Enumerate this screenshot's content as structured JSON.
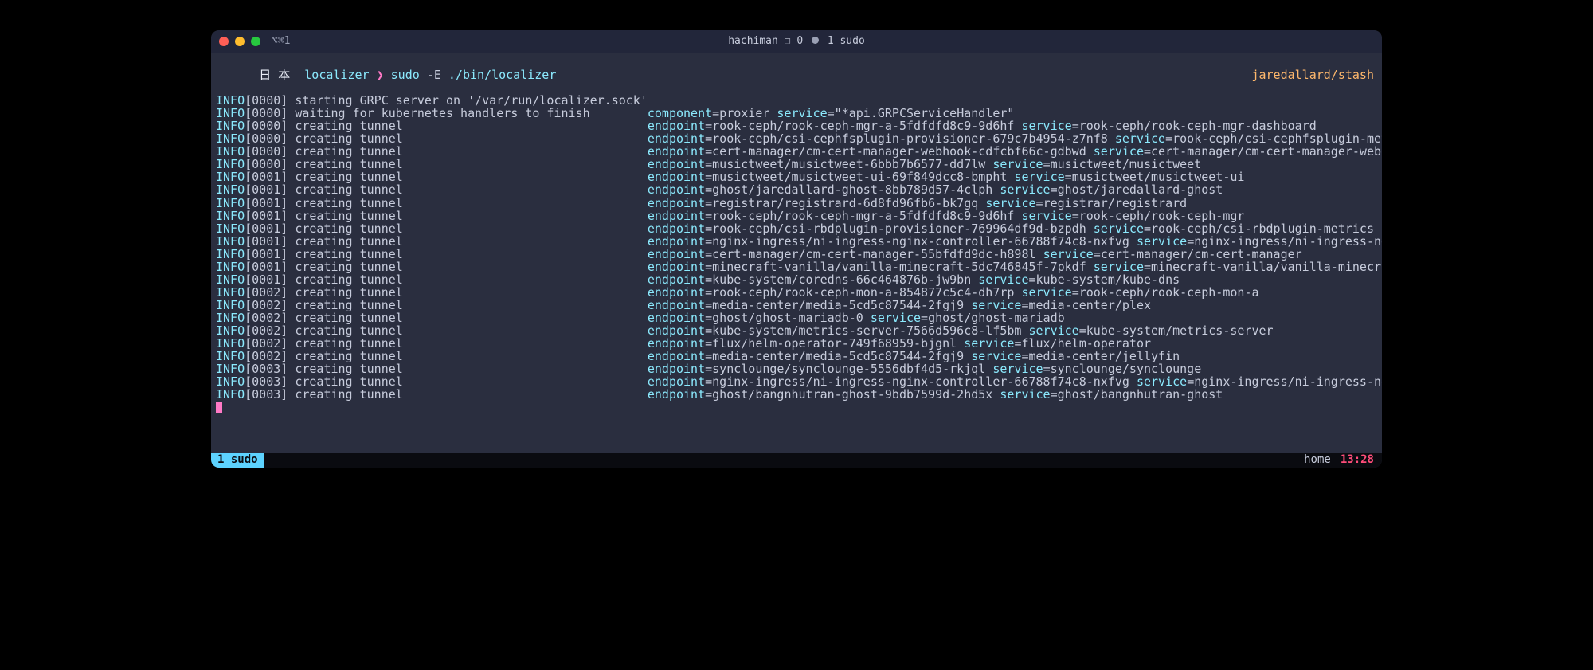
{
  "titlebar": {
    "left": "⌥⌘1",
    "host": "hachiman",
    "pane_glyph": "❐",
    "pane_count": "0",
    "proc": "1 sudo"
  },
  "prompt": {
    "prefix": "日 本 ",
    "host": "localizer",
    "caret": "❯",
    "cmd": "sudo",
    "flag": "-E",
    "path": "./bin/localizer",
    "branch": "jaredallard/stash"
  },
  "msg_col": 60,
  "logs": [
    {
      "level": "INFO",
      "ts": "0000",
      "msg": "starting GRPC server on '/var/run/localizer.sock'"
    },
    {
      "level": "INFO",
      "ts": "0000",
      "msg": "waiting for kubernetes handlers to finish",
      "kv": [
        [
          "component",
          "proxier"
        ],
        [
          "service",
          "\"*api.GRPCServiceHandler\""
        ]
      ]
    },
    {
      "level": "INFO",
      "ts": "0000",
      "msg": "creating tunnel",
      "kv": [
        [
          "endpoint",
          "rook-ceph/rook-ceph-mgr-a-5fdfdfd8c9-9d6hf"
        ],
        [
          "service",
          "rook-ceph/rook-ceph-mgr-dashboard"
        ]
      ]
    },
    {
      "level": "INFO",
      "ts": "0000",
      "msg": "creating tunnel",
      "kv": [
        [
          "endpoint",
          "rook-ceph/csi-cephfsplugin-provisioner-679c7b4954-z7nf8"
        ],
        [
          "service",
          "rook-ceph/csi-cephfsplugin-metrics"
        ]
      ]
    },
    {
      "level": "INFO",
      "ts": "0000",
      "msg": "creating tunnel",
      "kv": [
        [
          "endpoint",
          "cert-manager/cm-cert-manager-webhook-cdfcbf66c-gdbwd"
        ],
        [
          "service",
          "cert-manager/cm-cert-manager-webhook"
        ]
      ]
    },
    {
      "level": "INFO",
      "ts": "0000",
      "msg": "creating tunnel",
      "kv": [
        [
          "endpoint",
          "musictweet/musictweet-6bbb7b6577-dd7lw"
        ],
        [
          "service",
          "musictweet/musictweet"
        ]
      ]
    },
    {
      "level": "INFO",
      "ts": "0001",
      "msg": "creating tunnel",
      "kv": [
        [
          "endpoint",
          "musictweet/musictweet-ui-69f849dcc8-bmpht"
        ],
        [
          "service",
          "musictweet/musictweet-ui"
        ]
      ]
    },
    {
      "level": "INFO",
      "ts": "0001",
      "msg": "creating tunnel",
      "kv": [
        [
          "endpoint",
          "ghost/jaredallard-ghost-8bb789d57-4clph"
        ],
        [
          "service",
          "ghost/jaredallard-ghost"
        ]
      ]
    },
    {
      "level": "INFO",
      "ts": "0001",
      "msg": "creating tunnel",
      "kv": [
        [
          "endpoint",
          "registrar/registrard-6d8fd96fb6-bk7gq"
        ],
        [
          "service",
          "registrar/registrard"
        ]
      ]
    },
    {
      "level": "INFO",
      "ts": "0001",
      "msg": "creating tunnel",
      "kv": [
        [
          "endpoint",
          "rook-ceph/rook-ceph-mgr-a-5fdfdfd8c9-9d6hf"
        ],
        [
          "service",
          "rook-ceph/rook-ceph-mgr"
        ]
      ]
    },
    {
      "level": "INFO",
      "ts": "0001",
      "msg": "creating tunnel",
      "kv": [
        [
          "endpoint",
          "rook-ceph/csi-rbdplugin-provisioner-769964df9d-bzpdh"
        ],
        [
          "service",
          "rook-ceph/csi-rbdplugin-metrics"
        ]
      ]
    },
    {
      "level": "INFO",
      "ts": "0001",
      "msg": "creating tunnel",
      "kv": [
        [
          "endpoint",
          "nginx-ingress/ni-ingress-nginx-controller-66788f74c8-nxfvg"
        ],
        [
          "service",
          "nginx-ingress/ni-ingress-nginx-controller"
        ]
      ]
    },
    {
      "level": "INFO",
      "ts": "0001",
      "msg": "creating tunnel",
      "kv": [
        [
          "endpoint",
          "cert-manager/cm-cert-manager-55bfdfd9dc-h898l"
        ],
        [
          "service",
          "cert-manager/cm-cert-manager"
        ]
      ]
    },
    {
      "level": "INFO",
      "ts": "0001",
      "msg": "creating tunnel",
      "kv": [
        [
          "endpoint",
          "minecraft-vanilla/vanilla-minecraft-5dc746845f-7pkdf"
        ],
        [
          "service",
          "minecraft-vanilla/vanilla-minecraft"
        ]
      ]
    },
    {
      "level": "INFO",
      "ts": "0001",
      "msg": "creating tunnel",
      "kv": [
        [
          "endpoint",
          "kube-system/coredns-66c464876b-jw9bn"
        ],
        [
          "service",
          "kube-system/kube-dns"
        ]
      ]
    },
    {
      "level": "INFO",
      "ts": "0002",
      "msg": "creating tunnel",
      "kv": [
        [
          "endpoint",
          "rook-ceph/rook-ceph-mon-a-854877c5c4-dh7rp"
        ],
        [
          "service",
          "rook-ceph/rook-ceph-mon-a"
        ]
      ]
    },
    {
      "level": "INFO",
      "ts": "0002",
      "msg": "creating tunnel",
      "kv": [
        [
          "endpoint",
          "media-center/media-5cd5c87544-2fgj9"
        ],
        [
          "service",
          "media-center/plex"
        ]
      ]
    },
    {
      "level": "INFO",
      "ts": "0002",
      "msg": "creating tunnel",
      "kv": [
        [
          "endpoint",
          "ghost/ghost-mariadb-0"
        ],
        [
          "service",
          "ghost/ghost-mariadb"
        ]
      ]
    },
    {
      "level": "INFO",
      "ts": "0002",
      "msg": "creating tunnel",
      "kv": [
        [
          "endpoint",
          "kube-system/metrics-server-7566d596c8-lf5bm"
        ],
        [
          "service",
          "kube-system/metrics-server"
        ]
      ]
    },
    {
      "level": "INFO",
      "ts": "0002",
      "msg": "creating tunnel",
      "kv": [
        [
          "endpoint",
          "flux/helm-operator-749f68959-bjgnl"
        ],
        [
          "service",
          "flux/helm-operator"
        ]
      ]
    },
    {
      "level": "INFO",
      "ts": "0002",
      "msg": "creating tunnel",
      "kv": [
        [
          "endpoint",
          "media-center/media-5cd5c87544-2fgj9"
        ],
        [
          "service",
          "media-center/jellyfin"
        ]
      ]
    },
    {
      "level": "INFO",
      "ts": "0003",
      "msg": "creating tunnel",
      "kv": [
        [
          "endpoint",
          "synclounge/synclounge-5556dbf4d5-rkjql"
        ],
        [
          "service",
          "synclounge/synclounge"
        ]
      ]
    },
    {
      "level": "INFO",
      "ts": "0003",
      "msg": "creating tunnel",
      "kv": [
        [
          "endpoint",
          "nginx-ingress/ni-ingress-nginx-controller-66788f74c8-nxfvg"
        ],
        [
          "service",
          "nginx-ingress/ni-ingress-nginx-controller-admission"
        ]
      ]
    },
    {
      "level": "INFO",
      "ts": "0003",
      "msg": "creating tunnel",
      "kv": [
        [
          "endpoint",
          "ghost/bangnhutran-ghost-9bdb7599d-2hd5x"
        ],
        [
          "service",
          "ghost/bangnhutran-ghost"
        ]
      ]
    }
  ],
  "statusbar": {
    "window": " 1 sudo ",
    "host": "home",
    "time": "13:28"
  }
}
